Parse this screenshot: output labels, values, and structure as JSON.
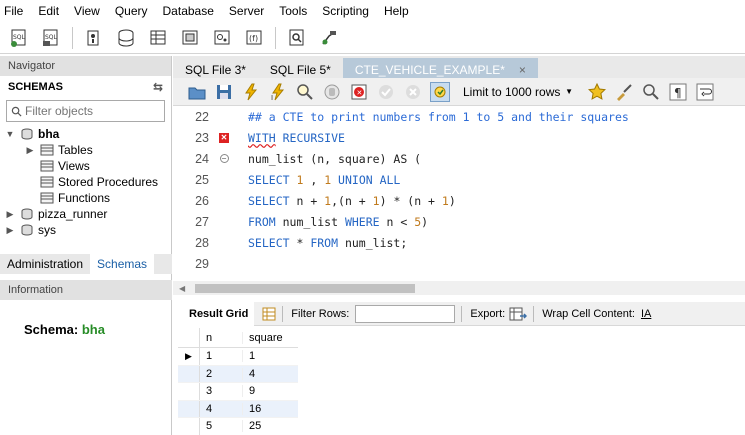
{
  "menu": [
    "File",
    "Edit",
    "View",
    "Query",
    "Database",
    "Server",
    "Tools",
    "Scripting",
    "Help"
  ],
  "navigator": {
    "title": "Navigator",
    "schemas_title": "SCHEMAS",
    "filter_placeholder": "Filter objects",
    "tree": {
      "db": "bha",
      "children": [
        "Tables",
        "Views",
        "Stored Procedures",
        "Functions"
      ],
      "others": [
        "pizza_runner",
        "sys"
      ]
    },
    "tabs": [
      "Administration",
      "Schemas"
    ],
    "info_title": "Information",
    "schema_label": "Schema:",
    "schema_value": "bha"
  },
  "editor": {
    "tabs": [
      "SQL File 3*",
      "SQL File 5*",
      "CTE_VEHICLE_EXAMPLE*"
    ],
    "limit": "Limit to 1000 rows",
    "lines": [
      22,
      23,
      24,
      25,
      26,
      27,
      28,
      29
    ],
    "code": {
      "l22": "## a CTE to print numbers from 1 to 5 and their squares",
      "l23a": "WITH",
      "l23b": " RECURSIVE",
      "l24": "num_list (n, square) AS (",
      "l25a": "SELECT ",
      "l25b": "1",
      "l25c": " , ",
      "l25d": "1",
      "l25e": " UNION ALL",
      "l26a": "SELECT ",
      "l26b": "n + ",
      "l26c": "1",
      "l26d": ",(n + ",
      "l26e": "1",
      "l26f": ") * (n + ",
      "l26g": "1",
      "l26h": ")",
      "l27a": "FROM ",
      "l27b": "num_list ",
      "l27c": "WHERE ",
      "l27d": "n < ",
      "l27e": "5",
      "l27f": ")",
      "l28a": "SELECT ",
      "l28b": "* ",
      "l28c": "FROM ",
      "l28d": "num_list;"
    }
  },
  "results": {
    "tab": "Result Grid",
    "filter_label": "Filter Rows:",
    "export_label": "Export:",
    "wrap_label": "Wrap Cell Content:",
    "columns": [
      "n",
      "square"
    ],
    "rows": [
      [
        "1",
        "1"
      ],
      [
        "2",
        "4"
      ],
      [
        "3",
        "9"
      ],
      [
        "4",
        "16"
      ],
      [
        "5",
        "25"
      ]
    ]
  }
}
